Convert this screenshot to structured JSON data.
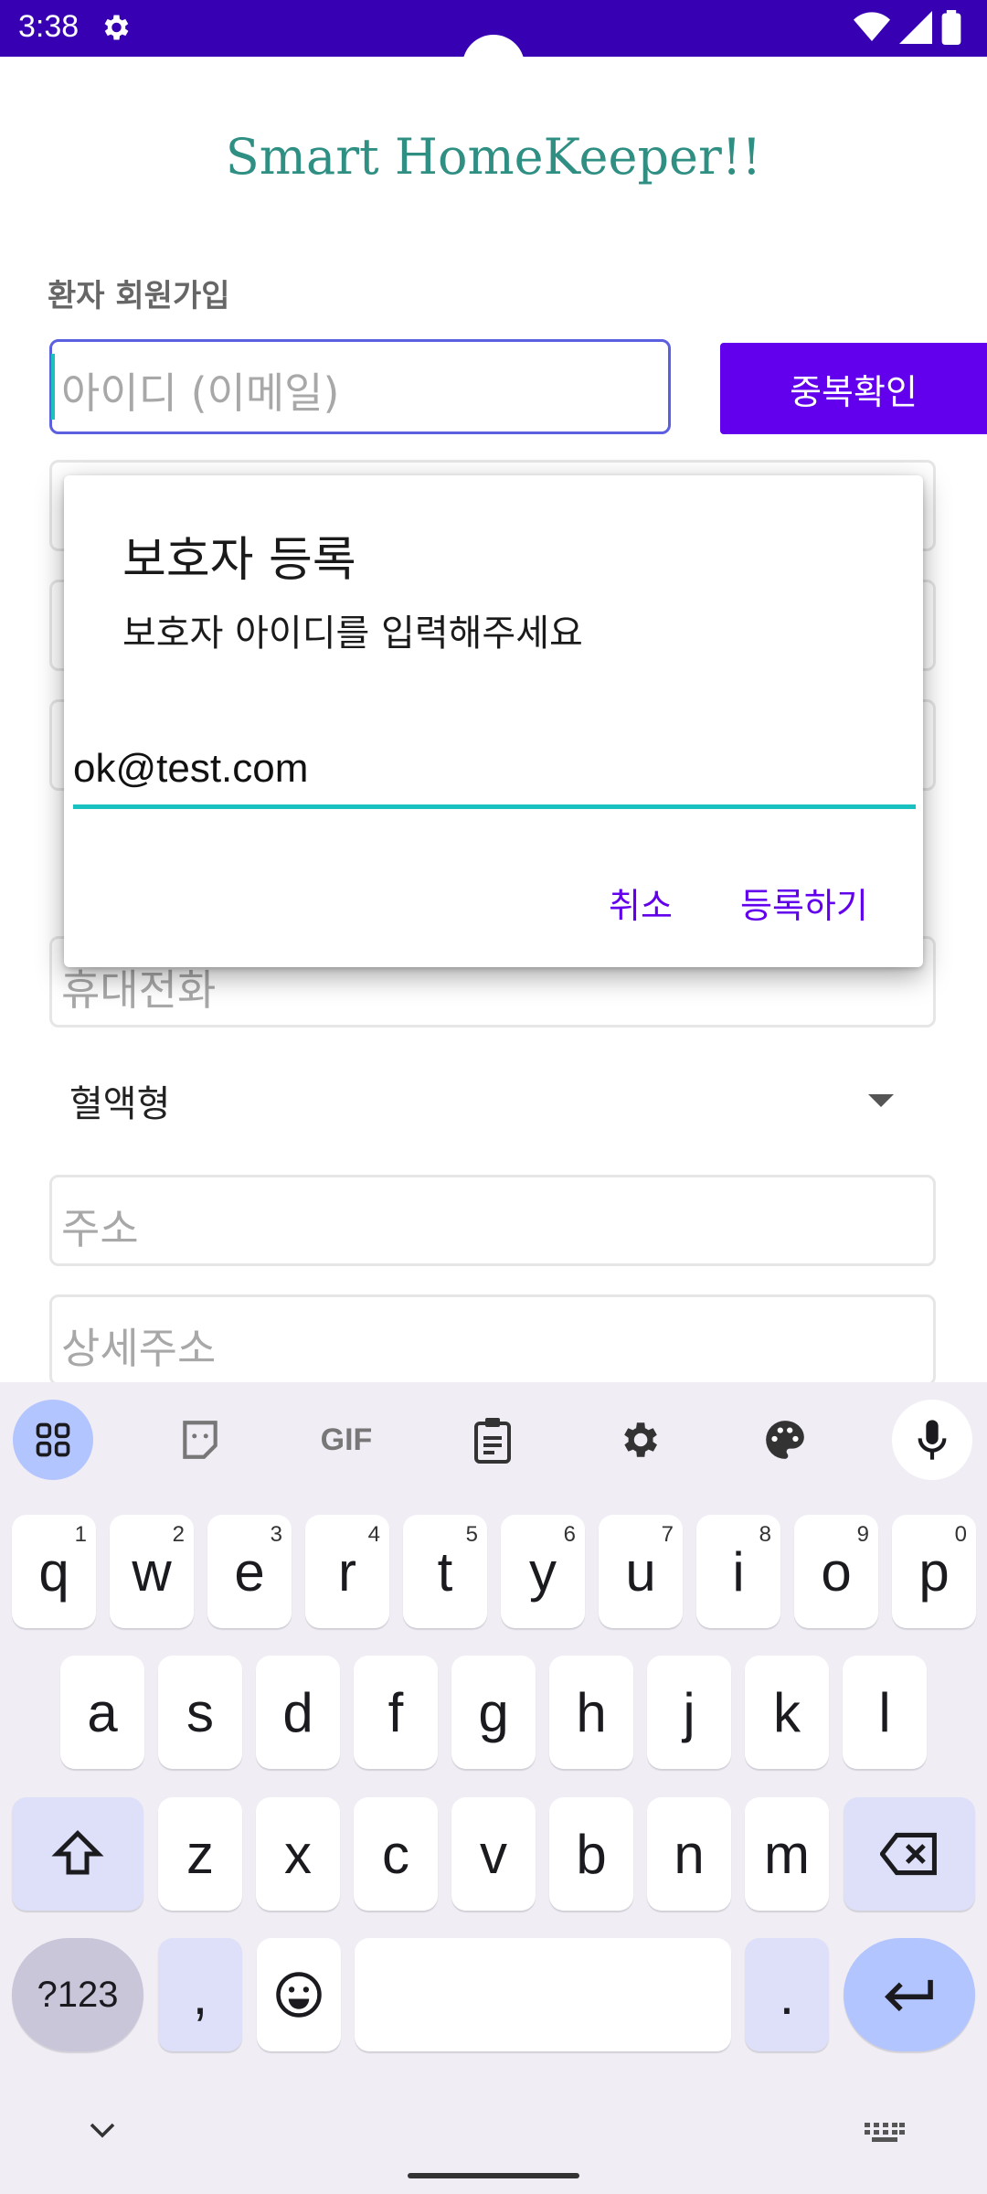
{
  "status_bar": {
    "time": "3:38"
  },
  "app": {
    "title": "Smart HomeKeeper!!",
    "form_heading": "환자 회원가입",
    "id_placeholder": "아이디 (이메일)",
    "duplicate_check_label": "중복확인",
    "phone_placeholder": "휴대전화",
    "blood_type_label": "혈액형",
    "address_placeholder": "주소",
    "detail_address_placeholder": "상세주소"
  },
  "dialog": {
    "title": "보호자 등록",
    "message": "보호자 아이디를 입력해주세요",
    "input_value": "ok@test.com",
    "cancel_label": "취소",
    "confirm_label": "등록하기"
  },
  "keyboard": {
    "toolbar": [
      "apps-icon",
      "sticker-icon",
      "gif-icon",
      "clipboard-icon",
      "settings-icon",
      "palette-icon",
      "mic-icon"
    ],
    "gif_label": "GIF",
    "row1": [
      {
        "k": "q",
        "h": "1"
      },
      {
        "k": "w",
        "h": "2"
      },
      {
        "k": "e",
        "h": "3"
      },
      {
        "k": "r",
        "h": "4"
      },
      {
        "k": "t",
        "h": "5"
      },
      {
        "k": "y",
        "h": "6"
      },
      {
        "k": "u",
        "h": "7"
      },
      {
        "k": "i",
        "h": "8"
      },
      {
        "k": "o",
        "h": "9"
      },
      {
        "k": "p",
        "h": "0"
      }
    ],
    "row2": [
      "a",
      "s",
      "d",
      "f",
      "g",
      "h",
      "j",
      "k",
      "l"
    ],
    "row3": [
      "z",
      "x",
      "c",
      "v",
      "b",
      "n",
      "m"
    ],
    "symbols_label": "?123",
    "comma_label": ",",
    "period_label": "."
  },
  "colors": {
    "status_bar": "#3700b3",
    "accent": "#6200ee",
    "title_teal": "#2f8f83",
    "input_focus": "#19c2c0"
  }
}
